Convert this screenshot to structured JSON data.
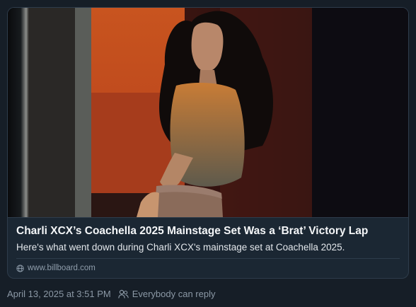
{
  "embed": {
    "title": "Charli XCX’s Coachella 2025 Mainstage Set Was a ‘Brat’ Victory Lap",
    "description": "Here's what went down during Charli XCX's mainstage set at Coachella 2025.",
    "source": "www.billboard.com",
    "source_icon": "globe-icon"
  },
  "post": {
    "timestamp": "April 13, 2025 at 3:51 PM",
    "reply_setting": "Everybody can reply",
    "reply_icon": "people-icon"
  },
  "colors": {
    "background": "#161e27",
    "card_border": "#2e3c4b",
    "secondary_text": "#8b98a5"
  }
}
